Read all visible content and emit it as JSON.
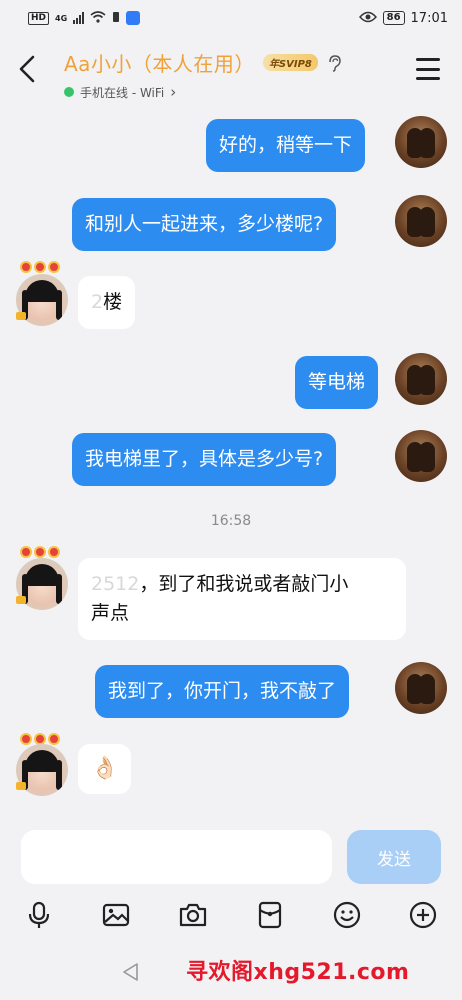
{
  "status_bar": {
    "network_badge": "HD",
    "network_type": "4G",
    "battery": "86",
    "time": "17:01"
  },
  "header": {
    "contact_name": "Aa小小（本人在用）",
    "vip_badge": "年SVIP8",
    "online_status": "手机在线 - WiFi",
    "online_chevron": "›"
  },
  "messages": [
    {
      "direction": "out",
      "text": "好的，稍等一下"
    },
    {
      "direction": "out",
      "text": "和别人一起进来，多少楼呢?"
    },
    {
      "direction": "in",
      "hidden": "2",
      "text": "楼"
    },
    {
      "direction": "out",
      "text": "等电梯"
    },
    {
      "direction": "out",
      "text": "我电梯里了，具体是多少号?"
    },
    {
      "direction": "time",
      "text": "16:58"
    },
    {
      "direction": "in",
      "hidden": "2512",
      "text": "，到了和我说或者敲门小",
      "text2": "声点"
    },
    {
      "direction": "out",
      "text": "我到了，你开门，我不敲了"
    },
    {
      "direction": "in",
      "text": "👌🏻"
    }
  ],
  "composer": {
    "placeholder": "",
    "send_label": "发送"
  },
  "toolbar": {
    "icons": [
      "microphone-icon",
      "image-icon",
      "camera-icon",
      "red-packet-icon",
      "emoji-icon",
      "plus-icon"
    ]
  },
  "watermark": "寻欢阁xhg521.com",
  "colors": {
    "accent": "#2d8cf0",
    "name": "#f0a13a",
    "online": "#35c46a",
    "send_disabled": "#a9cff6",
    "watermark": "#e41a2c"
  }
}
